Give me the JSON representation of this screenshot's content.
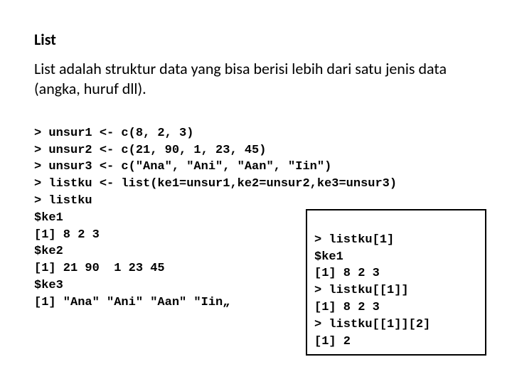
{
  "heading": "List",
  "description": "List adalah struktur data yang bisa berisi lebih dari satu jenis data (angka, huruf dll).",
  "code": {
    "l1": "> unsur1 <- c(8, 2, 3)",
    "l2": "> unsur2 <- c(21, 90, 1, 23, 45)",
    "l3": "> unsur3 <- c(\"Ana\", \"Ani\", \"Aan\", \"Iin\")",
    "l4": "> listku <- list(ke1=unsur1,ke2=unsur2,ke3=unsur3)",
    "l5": "> listku",
    "l6": "$ke1",
    "l7": "[1] 8 2 3",
    "l8": "$ke2",
    "l9": "[1] 21 90  1 23 45",
    "l10": "$ke3",
    "l11": "[1] \"Ana\" \"Ani\" \"Aan\" \"Iin„"
  },
  "inset": {
    "l1": "> listku[1]",
    "l2": "$ke1",
    "l3": "[1] 8 2 3",
    "l4": "> listku[[1]]",
    "l5": "[1] 8 2 3",
    "l6": "> listku[[1]][2]",
    "l7": "[1] 2"
  }
}
